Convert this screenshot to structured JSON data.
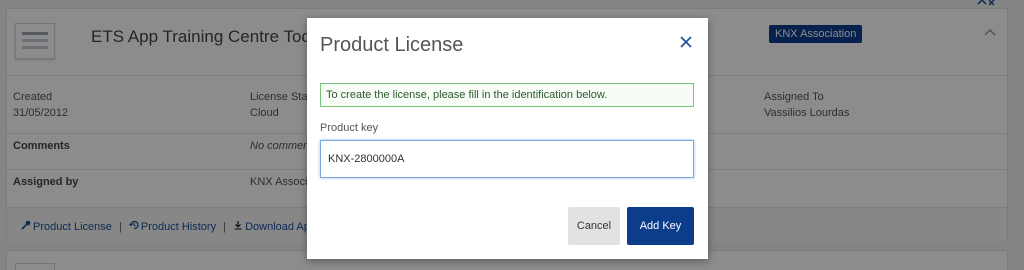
{
  "background": {
    "card": {
      "app_title": "ETS App Training Centre Tool",
      "badge": "KNX Association",
      "fields": [
        {
          "label": "Created",
          "value": "31/05/2012"
        },
        {
          "label": "License Stat",
          "value": "Cloud"
        },
        {
          "label": "Assigned To",
          "value": "Vassilios Lourdas"
        }
      ],
      "comments_label": "Comments",
      "comments_value": "No commer",
      "assigned_by_label": "Assigned by",
      "assigned_by_value": "KNX Associa"
    },
    "footer_links": [
      {
        "label": "Product License",
        "icon": "key-icon"
      },
      {
        "label": "Product History",
        "icon": "history-icon"
      },
      {
        "label": "Download App",
        "icon": "download-icon"
      }
    ],
    "footer_separator": "|"
  },
  "modal": {
    "title": "Product License",
    "close_icon": "close-icon",
    "info_message": "To create the license, please fill in the identification below.",
    "field_label": "Product key",
    "field_value": "KNX-2800000A",
    "cancel_label": "Cancel",
    "add_label": "Add Key"
  },
  "colors": {
    "brand_blue": "#0b3d8c",
    "link_blue": "#1a4f9c",
    "info_border": "#7cc47c",
    "overlay": "rgba(0,0,0,0.45)"
  }
}
